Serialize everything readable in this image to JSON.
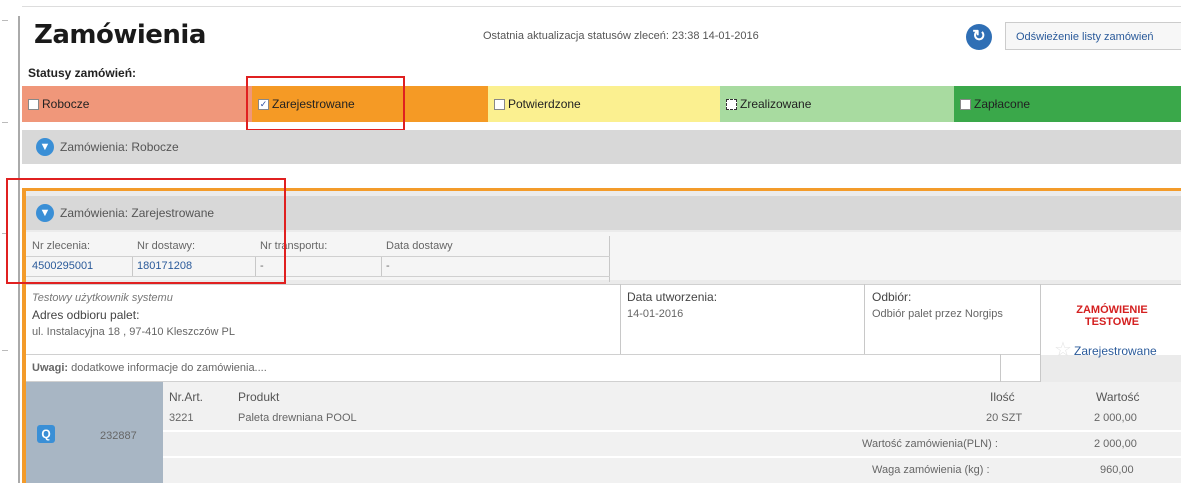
{
  "header": {
    "title": "Zamówienia",
    "last_update": "Ostatnia aktualizacja statusów zleceń: 23:38 14-01-2016",
    "refresh_label": "Odświeżenie listy zamówień"
  },
  "statuses": {
    "label": "Statusy zamówień:",
    "items": [
      {
        "label": "Robocze",
        "checked": false,
        "color": "#f0977a"
      },
      {
        "label": "Zarejestrowane",
        "checked": true,
        "color": "#f59a25"
      },
      {
        "label": "Potwierdzone",
        "checked": false,
        "color": "#fbf090"
      },
      {
        "label": "Zrealizowane",
        "checked": false,
        "color": "#a8dba0"
      },
      {
        "label": "Zapłacone",
        "checked": false,
        "color": "#3aa84a"
      }
    ]
  },
  "sections": {
    "robocze": "Zamówienia: Robocze",
    "zarejestrowane": "Zamówienia: Zarejestrowane"
  },
  "order": {
    "nr_zlecenia_label": "Nr zlecenia:",
    "nr_zlecenia": "4500295001",
    "nr_dostawy_label": "Nr dostawy:",
    "nr_dostawy": "180171208",
    "nr_transportu_label": "Nr transportu:",
    "nr_transportu": "-",
    "data_dostawy_label": "Data dostawy",
    "data_dostawy": "-",
    "user": "Testowy użytkownik systemu",
    "address_label": "Adres odbioru palet:",
    "address": "ul. Instalacyjna 18 , 97-410 Kleszczów PL",
    "created_label": "Data utworzenia:",
    "created": "14-01-2016",
    "pickup_label": "Odbiór:",
    "pickup": "Odbiór palet przez Norgips",
    "test_label": "ZAMÓWIENIE TESTOWE",
    "status": "Zarejestrowane",
    "notes_label": "Uwagi:",
    "notes": "dodatkowe informacje do zamówienia....",
    "id": "232887",
    "columns": {
      "nr_art": "Nr.Art.",
      "produkt": "Produkt",
      "ilosc": "Ilość",
      "wartosc": "Wartość"
    },
    "items": [
      {
        "nr_art": "3221",
        "produkt": "Paleta drewniana POOL",
        "ilosc": "20 SZT",
        "wartosc": "2 000,00"
      }
    ],
    "total_value_label": "Wartość zamówienia(PLN) :",
    "total_value": "2 000,00",
    "weight_label": "Waga zamówienia (kg) :",
    "weight": "960,00"
  }
}
